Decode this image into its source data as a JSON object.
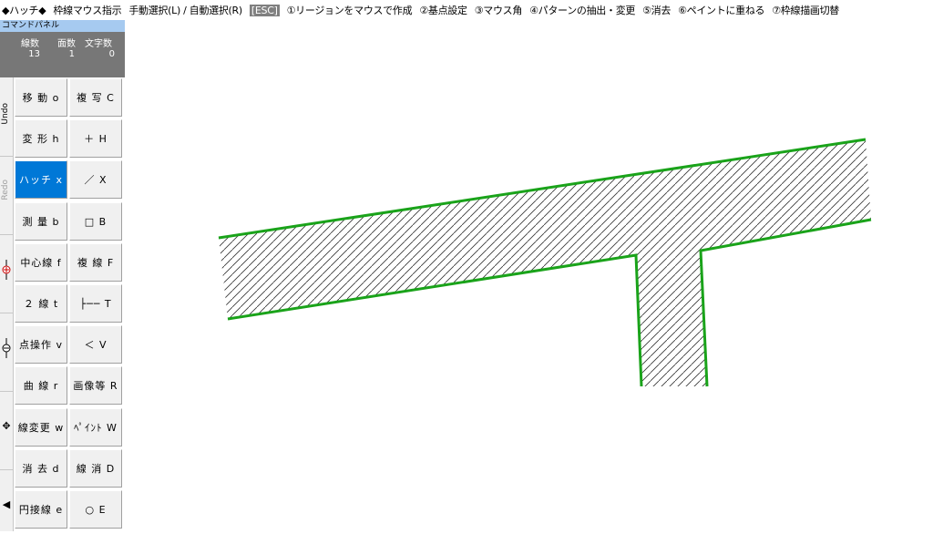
{
  "topbar": {
    "mode": "◆ハッチ◆",
    "items": [
      "枠線マウス指示",
      "手動選択(L) / 自動選択(R)",
      "[ESC]",
      "①リージョンをマウスで作成",
      "②基点設定",
      "③マウス角",
      "④パターンの抽出・変更",
      "⑤消去",
      "⑥ペイントに重ねる",
      "⑦枠線描画切替"
    ]
  },
  "panel": {
    "title": "コマンドパネル",
    "counters": [
      {
        "label": "線数",
        "value": "13"
      },
      {
        "label": "面数",
        "value": "1"
      },
      {
        "label": "文字数",
        "value": "0"
      }
    ]
  },
  "strip": {
    "undo": "Undo",
    "redo": "Redo",
    "icons": [
      "zoom-in-icon",
      "zoom-out-icon",
      "pan-move-icon",
      "arrow-left-icon"
    ]
  },
  "buttons": {
    "left": [
      "移 動 o",
      "変 形 h",
      "ハッチ x",
      "測 量 b",
      "中心線 f",
      "２ 線 t",
      "点操作 v",
      "曲 線 r",
      "線変更 w",
      "消 去 d",
      "円接線 e"
    ],
    "right": [
      "複 写 C",
      "＋ H",
      "／ X",
      "□ B",
      "複 線 F",
      "├── T",
      "＜ V",
      "画像等 R",
      "ﾍﾟｲﾝﾄ W",
      "線 消 D",
      "○ E"
    ],
    "active": "ハッチ x"
  },
  "colors": {
    "active_button": "#0078d7",
    "boundary_line": "#1aa31a",
    "hatch_line": "#333333",
    "panel_title_bg": "#a6caf0",
    "counter_bg": "#777777"
  }
}
